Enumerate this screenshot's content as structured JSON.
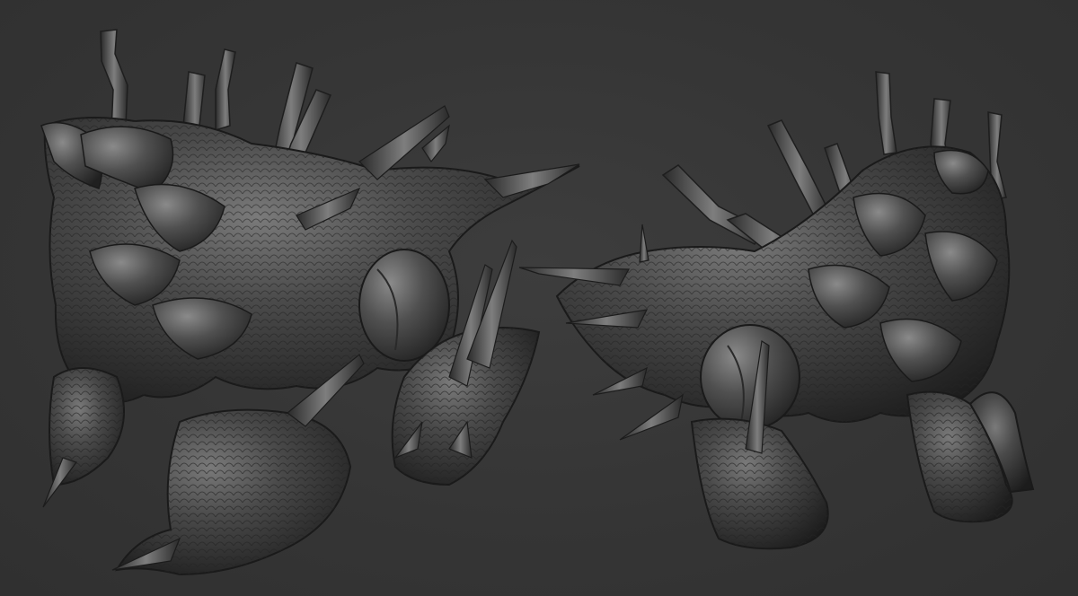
{
  "scene": {
    "subject": "sculpt-render",
    "palette": {
      "background": "#363636",
      "clay_dark": "#1e1e1e",
      "clay_mid": "#3a3a3a",
      "clay_light": "#6a6a6a",
      "clay_highlight": "#8c8c8c"
    }
  }
}
